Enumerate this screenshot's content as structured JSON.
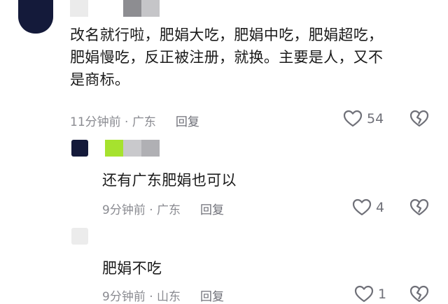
{
  "comments": [
    {
      "text_lines": [
        "改名就行啦，肥娟大吃，肥娟中吃，肥娟超吃，",
        "肥娟慢吃，反正被注册，就换。主要是人，又不",
        "是商标。"
      ],
      "time_location": "11分钟前 · 广东",
      "reply_label": "回复",
      "like_count": "54"
    },
    {
      "text_lines": [
        "还有广东肥娟也可以"
      ],
      "time_location": "9分钟前 · 广东",
      "reply_label": "回复",
      "like_count": "4"
    },
    {
      "text_lines": [
        "肥娟不吃"
      ],
      "time_location": "9分钟前 · 山东",
      "reply_label": "回复",
      "like_count": "1"
    }
  ],
  "colors": {
    "avatar_dark": "#141a3a",
    "username_green": "#a6e22e",
    "username_gray": "#c9c9cc",
    "icon_gray": "#6f7078"
  },
  "icons": [
    "heart-outline-icon",
    "broken-heart-icon"
  ]
}
